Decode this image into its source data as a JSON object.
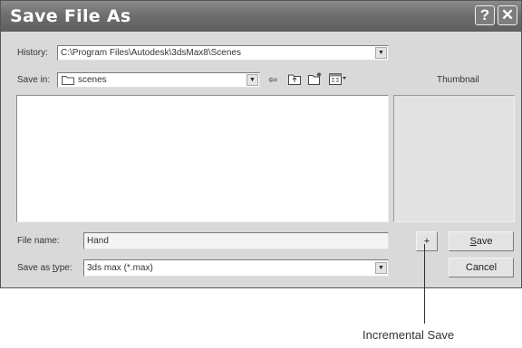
{
  "dialog": {
    "title": "Save File As",
    "help_button": "?",
    "close_button": "✕"
  },
  "history": {
    "label": "History:",
    "value": "C:\\Program Files\\Autodesk\\3dsMax8\\Scenes"
  },
  "save_in": {
    "label": "Save in:",
    "value": "scenes"
  },
  "thumbnail": {
    "label": "Thumbnail"
  },
  "file_name": {
    "label": "File name:",
    "value": "Hand"
  },
  "save_as_type": {
    "label": "Save as type:",
    "value": "3ds max (*.max)"
  },
  "buttons": {
    "increment": "+",
    "save": "Save",
    "cancel": "Cancel"
  },
  "annotation": {
    "text": "Incremental Save"
  }
}
